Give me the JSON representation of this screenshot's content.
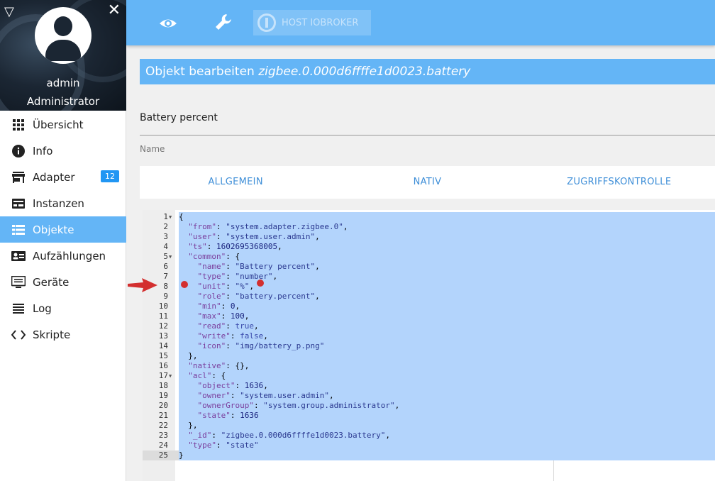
{
  "sidebar": {
    "user_name": "admin",
    "user_role": "Administrator",
    "items": [
      {
        "label": "Übersicht",
        "icon": "apps-grid-icon"
      },
      {
        "label": "Info",
        "icon": "info-icon"
      },
      {
        "label": "Adapter",
        "icon": "store-icon",
        "badge": "12"
      },
      {
        "label": "Instanzen",
        "icon": "instances-icon"
      },
      {
        "label": "Objekte",
        "icon": "list-icon",
        "active": true
      },
      {
        "label": "Aufzählungen",
        "icon": "contact-card-icon"
      },
      {
        "label": "Geräte",
        "icon": "monitor-icon"
      },
      {
        "label": "Log",
        "icon": "menu-lines-icon"
      },
      {
        "label": "Skripte",
        "icon": "code-icon"
      }
    ]
  },
  "toolbar": {
    "host_label": "HOST IOBROKER"
  },
  "editor_title": {
    "prefix": "Objekt bearbeiten ",
    "object_id": "zigbee.0.000d6ffffe1d0023.battery"
  },
  "name_field": {
    "value": "Battery percent",
    "label": "Name"
  },
  "tabs": [
    "ALLGEMEIN",
    "NATIV",
    "ZUGRIFFSKONTROLLE"
  ],
  "code": {
    "current_line": 25,
    "lines": [
      {
        "n": "1",
        "fold": true,
        "t": "{"
      },
      {
        "n": "2",
        "t": "  \"from\": \"system.adapter.zigbee.0\","
      },
      {
        "n": "3",
        "t": "  \"user\": \"system.user.admin\","
      },
      {
        "n": "4",
        "t": "  \"ts\": 1602695368005,"
      },
      {
        "n": "5",
        "fold": true,
        "t": "  \"common\": {"
      },
      {
        "n": "6",
        "t": "    \"name\": \"Battery percent\","
      },
      {
        "n": "7",
        "t": "    \"type\": \"number\","
      },
      {
        "n": "8",
        "t": "    \"unit\": \"%\","
      },
      {
        "n": "9",
        "t": "    \"role\": \"battery.percent\","
      },
      {
        "n": "10",
        "t": "    \"min\": 0,"
      },
      {
        "n": "11",
        "t": "    \"max\": 100,"
      },
      {
        "n": "12",
        "t": "    \"read\": true,"
      },
      {
        "n": "13",
        "t": "    \"write\": false,"
      },
      {
        "n": "14",
        "t": "    \"icon\": \"img/battery_p.png\""
      },
      {
        "n": "15",
        "t": "  },"
      },
      {
        "n": "16",
        "t": "  \"native\": {},"
      },
      {
        "n": "17",
        "fold": true,
        "t": "  \"acl\": {"
      },
      {
        "n": "18",
        "t": "    \"object\": 1636,"
      },
      {
        "n": "19",
        "t": "    \"owner\": \"system.user.admin\","
      },
      {
        "n": "20",
        "t": "    \"ownerGroup\": \"system.group.administrator\","
      },
      {
        "n": "21",
        "t": "    \"state\": 1636"
      },
      {
        "n": "22",
        "t": "  },"
      },
      {
        "n": "23",
        "t": "  \"_id\": \"zigbee.0.000d6ffffe1d0023.battery\","
      },
      {
        "n": "24",
        "t": "  \"type\": \"state\""
      },
      {
        "n": "25",
        "t": "}"
      }
    ]
  },
  "colors": {
    "accent": "#64b5f6",
    "selection": "#b3d4fc",
    "annotation": "#d32f2f"
  }
}
